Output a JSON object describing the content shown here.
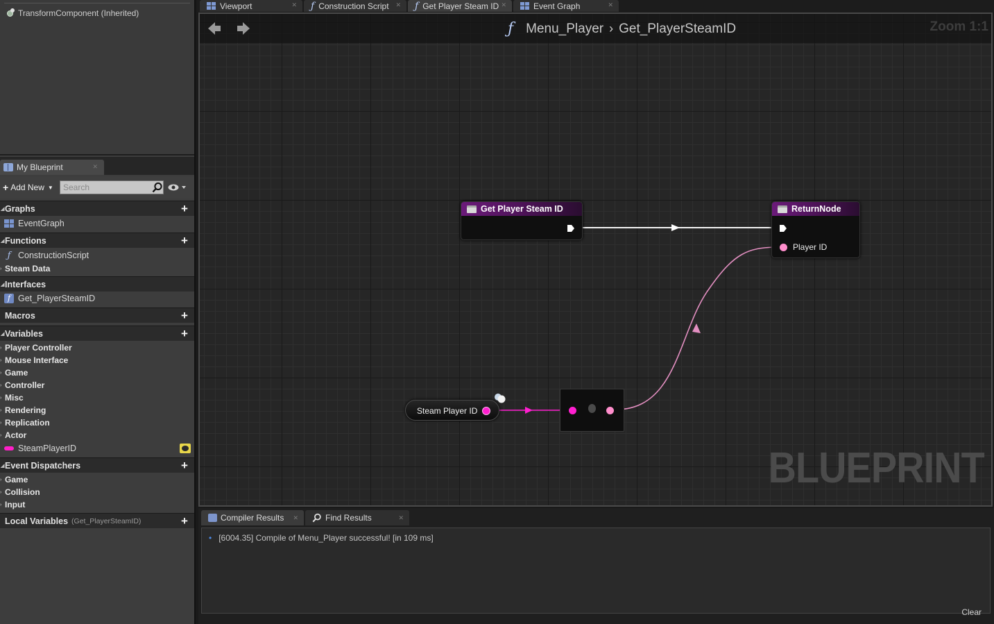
{
  "components": {
    "item": "TransformComponent (Inherited)"
  },
  "my_blueprint": {
    "tab_label": "My Blueprint",
    "add_new_label": "Add New",
    "search_placeholder": "Search",
    "sections": {
      "graphs": "Graphs",
      "functions": "Functions",
      "interfaces": "Interfaces",
      "macros": "Macros",
      "variables": "Variables",
      "event_dispatchers": "Event Dispatchers",
      "local_variables": "Local Variables",
      "local_variables_sub": "(Get_PlayerSteamID)"
    },
    "graph_items": [
      "EventGraph"
    ],
    "function_items": [
      "ConstructionScript"
    ],
    "function_categories": [
      "Steam Data"
    ],
    "interface_items": [
      "Get_PlayerSteamID"
    ],
    "variable_categories": [
      "Player Controller",
      "Mouse Interface",
      "Game",
      "Controller",
      "Misc",
      "Rendering",
      "Replication",
      "Actor"
    ],
    "variable_items": [
      "SteamPlayerID"
    ],
    "dispatcher_categories": [
      "Game",
      "Collision",
      "Input"
    ]
  },
  "tabs": [
    {
      "label": "Viewport",
      "icon": "viewport-icon"
    },
    {
      "label": "Construction Script",
      "icon": "function-icon"
    },
    {
      "label": "Get Player Steam ID",
      "icon": "function-icon"
    },
    {
      "label": "Event Graph",
      "icon": "event-graph-icon"
    }
  ],
  "graph": {
    "breadcrumb_blueprint": "Menu_Player",
    "breadcrumb_function": "Get_PlayerSteamID",
    "zoom": "Zoom 1:1",
    "watermark": "BLUEPRINT",
    "nodes": {
      "entry_title": "Get Player Steam ID",
      "return_title": "ReturnNode",
      "return_pin": "Player ID",
      "var_get_label": "Steam Player ID"
    },
    "colors": {
      "node_header": "#6b1a7a",
      "string_pin": "#ff1fd0",
      "return_pin": "#ff8ecc",
      "exec_wire": "#ffffff"
    }
  },
  "bottom": {
    "tabs": [
      "Compiler Results",
      "Find Results"
    ],
    "log": "[6004.35] Compile of Menu_Player successful! [in 109 ms]",
    "clear_label": "Clear"
  }
}
